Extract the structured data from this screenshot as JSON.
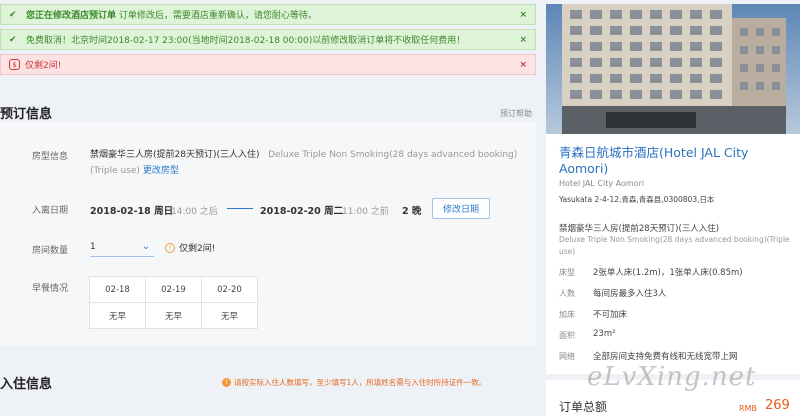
{
  "alerts": [
    {
      "bold": "您正在修改酒店预订单",
      "text": "订单修改后，需要酒店重新确认，请您耐心等待。",
      "close": "×"
    },
    {
      "bold": "",
      "text": "免费取消！北京时间2018-02-17 23:00(当地时间2018-02-18 00:00)以前修改取消订单将不收取任何费用！",
      "close": "×"
    },
    {
      "bold": "",
      "text": "仅剩2间!",
      "close": "×"
    }
  ],
  "booking": {
    "title": "预订信息",
    "help": "预订帮助",
    "room_type_label": "房型信息",
    "room_name_cn": "禁烟豪华三人房(提前28天预订)(三人入住)",
    "room_name_en": "Deluxe Triple Non Smoking(28 days advanced booking)(Triple use)",
    "change_room": "更改房型",
    "dates_label": "入离日期",
    "checkin_date": "2018-02-18 周日",
    "checkin_time": "14:00 之后",
    "checkout_date": "2018-02-20 周二",
    "checkout_time": "11:00 之前",
    "nights": "2 晚",
    "change_date": "修改日期",
    "qty_label": "房间数量",
    "qty_value": "1",
    "qty_tip": "仅剩2间!",
    "breakfast_label": "早餐情况",
    "breakfast": [
      {
        "date": "02-18",
        "value": "无早"
      },
      {
        "date": "02-19",
        "value": "无早"
      },
      {
        "date": "02-20",
        "value": "无早"
      }
    ]
  },
  "guest": {
    "title": "入住信息",
    "note": "请按实际入住人数填写，至少填写1人，所填姓名需与入住时所持证件一致。"
  },
  "hotel": {
    "name": "青森日航城市酒店(Hotel JAL City Aomori)",
    "name_en": "Hotel JAL City Aomori",
    "address": "Yasukata 2-4-12,青森,青森县,0300803,日本",
    "room_cn": "禁烟豪华三人房(提前28天预订)(三人入住)",
    "room_en": "Deluxe Triple Non Smoking(28 days advanced booking)(Triple use)",
    "specs": [
      {
        "label": "床型",
        "value": "2张单人床(1.2m)，1张单人床(0.85m)"
      },
      {
        "label": "人数",
        "value": "每间房最多入住3人"
      },
      {
        "label": "加床",
        "value": "不可加床"
      },
      {
        "label": "面积",
        "value": "23m²"
      },
      {
        "label": "网络",
        "value": "全部房间支持免费有线和无线宽带上网"
      }
    ]
  },
  "order": {
    "title": "订单总额",
    "currency": "RMB",
    "price": "269"
  },
  "watermark": "eLvXing.net",
  "colors": {
    "accent": "#2c7ac7",
    "success": "#3c8a2c",
    "danger": "#d0363a",
    "price": "#e85a1b"
  }
}
